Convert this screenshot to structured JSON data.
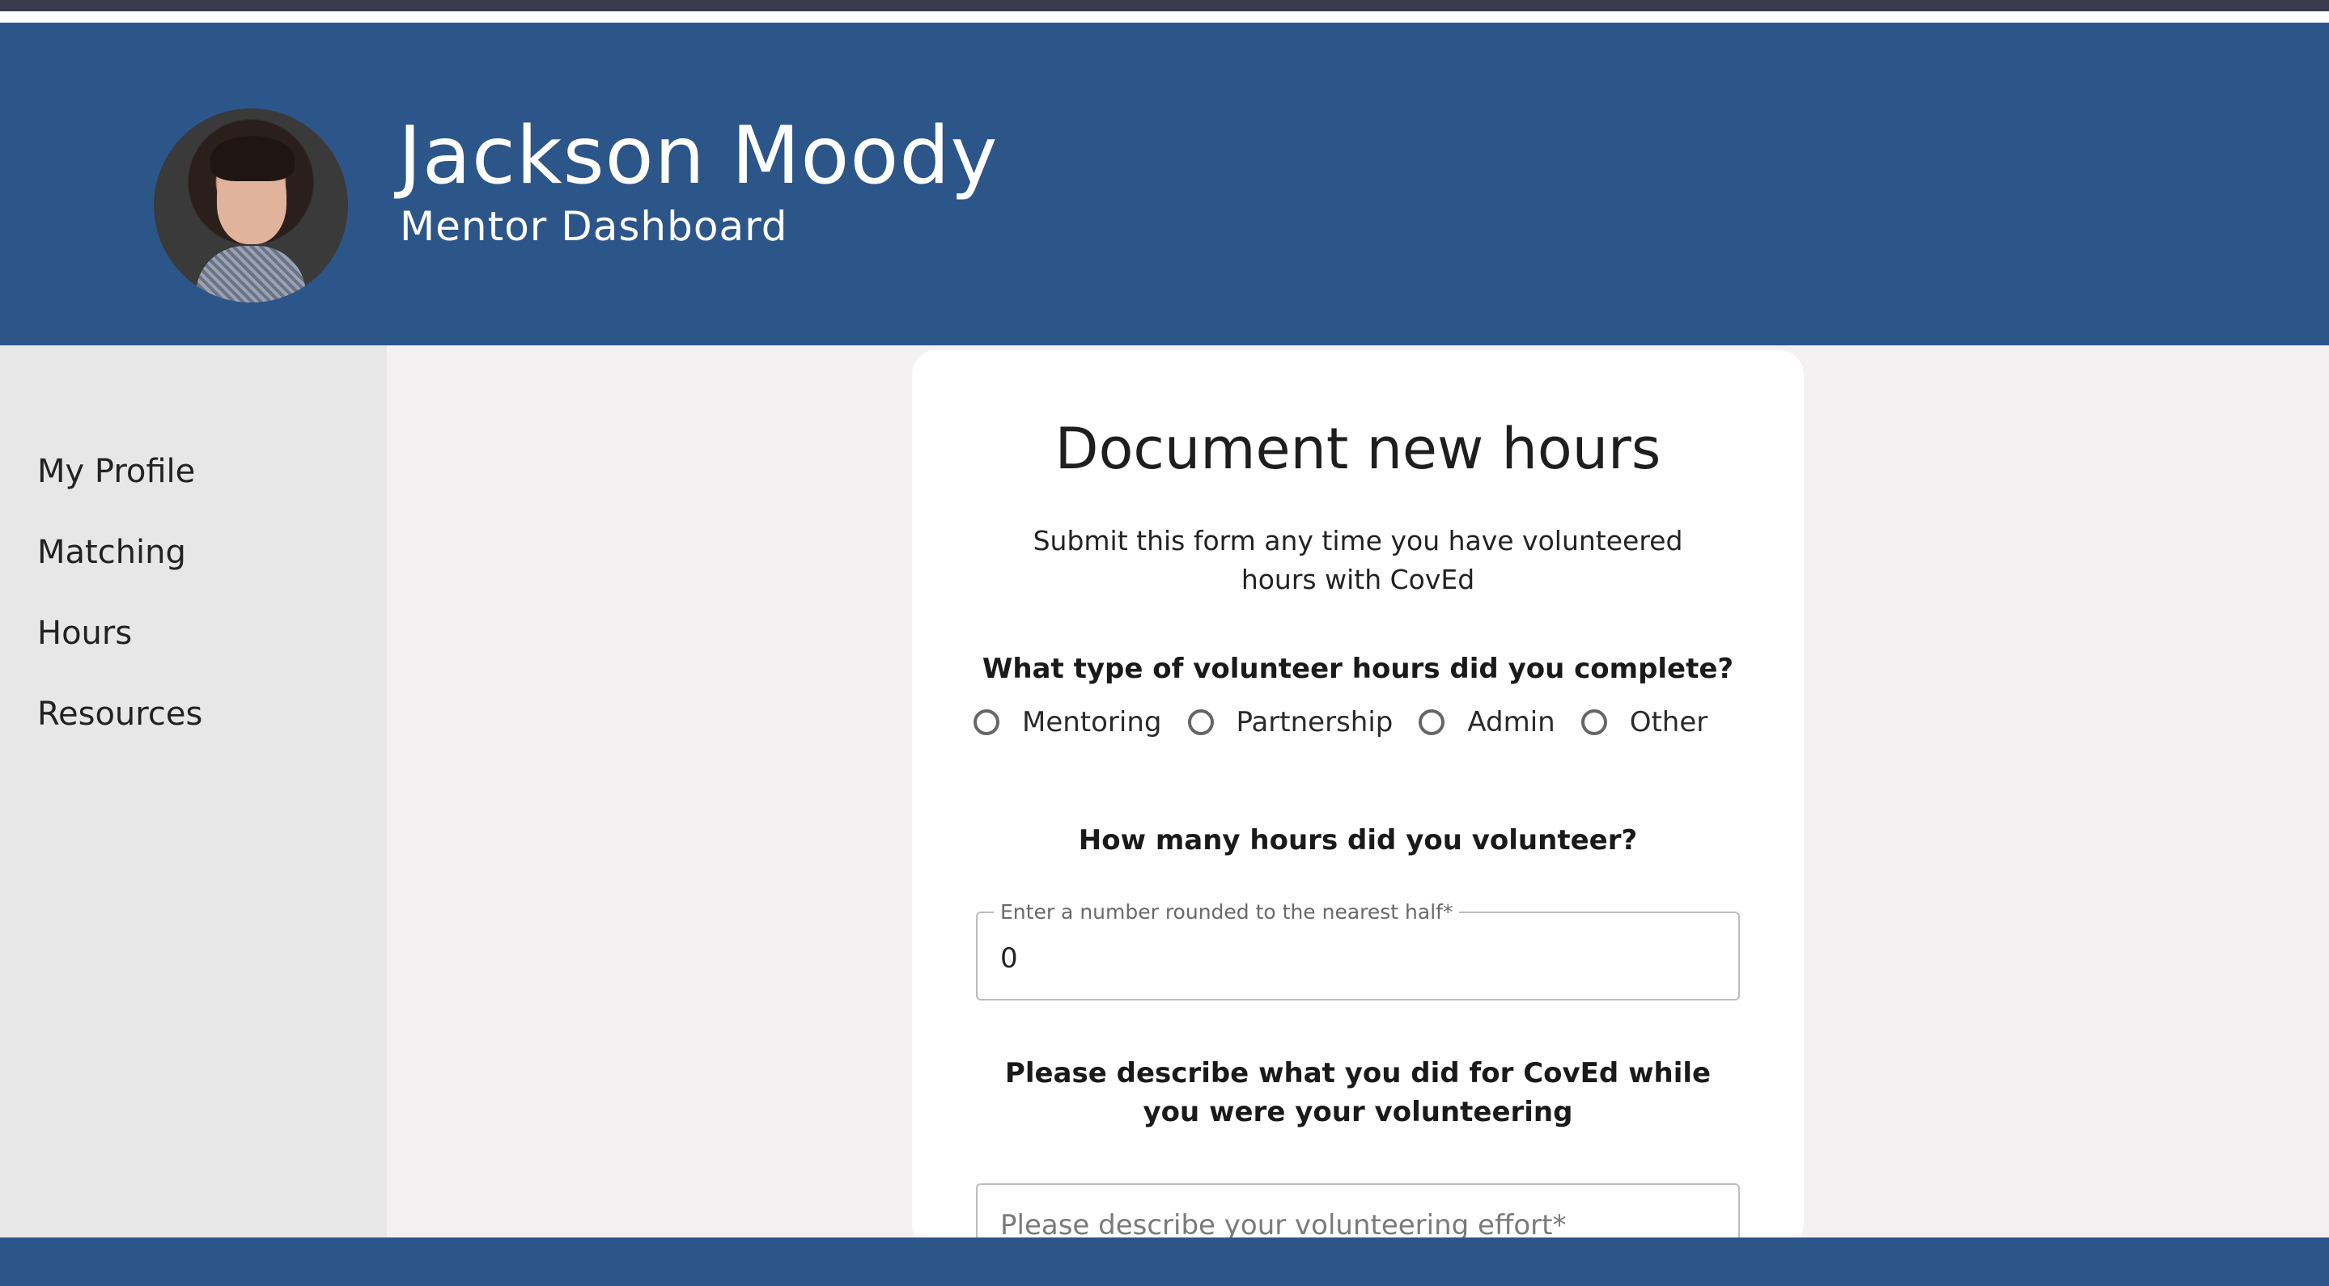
{
  "header": {
    "name": "Jackson Moody",
    "subtitle": "Mentor Dashboard",
    "avatar_icon": "user-photo",
    "background_color": "#2c5689"
  },
  "sidebar": {
    "items": [
      {
        "label": "My Profile"
      },
      {
        "label": "Matching"
      },
      {
        "label": "Hours"
      },
      {
        "label": "Resources"
      }
    ]
  },
  "form": {
    "title": "Document new hours",
    "description": "Submit this form any time you have volunteered hours with CovEd",
    "type_question": "What type of volunteer hours did you complete?",
    "type_options": [
      "Mentoring",
      "Partnership",
      "Admin",
      "Other"
    ],
    "hours_question": "How many hours did you volunteer?",
    "hours_field": {
      "label": "Enter a number rounded to the nearest half*",
      "value": "0"
    },
    "describe_question": "Please describe what you did for CovEd while you were your volunteering",
    "describe_field": {
      "placeholder": "Please describe your volunteering effort*"
    }
  }
}
